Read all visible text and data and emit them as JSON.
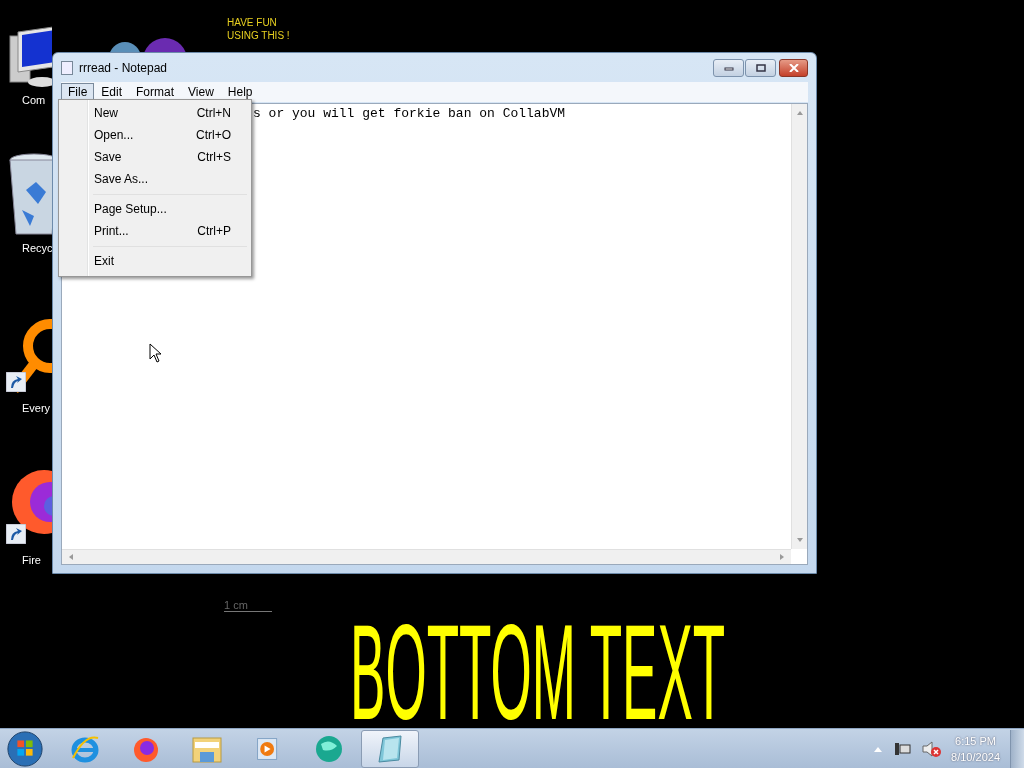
{
  "desktop_icons": [
    {
      "kind": "computer",
      "label": "Com"
    },
    {
      "kind": "recycle-bin",
      "label": "Recyc"
    },
    {
      "kind": "magnifier",
      "label": "Every",
      "shortcut": true
    },
    {
      "kind": "firefox",
      "label": "Fire",
      "shortcut": true
    }
  ],
  "note": [
    "HAVE FUN",
    "USING THIS !"
  ],
  "scale_label": "1 cm",
  "caption": "BOTTOM TEXT",
  "window": {
    "title": "rrread - Notepad",
    "menus": [
      {
        "label": "File",
        "selected": true
      },
      {
        "label": "Edit",
        "selected": false
      },
      {
        "label": "Format",
        "selected": false
      },
      {
        "label": "View",
        "selected": false
      },
      {
        "label": "Help",
        "selected": false
      }
    ],
    "open_menu": [
      {
        "kind": "item",
        "label": "New",
        "shortcut": "Ctrl+N"
      },
      {
        "kind": "item",
        "label": "Open...",
        "shortcut": "Ctrl+O"
      },
      {
        "kind": "item",
        "label": "Save",
        "shortcut": "Ctrl+S"
      },
      {
        "kind": "item",
        "label": "Save As..."
      },
      {
        "kind": "separator"
      },
      {
        "kind": "item",
        "label": "Page Setup..."
      },
      {
        "kind": "item",
        "label": "Print...",
        "shortcut": "Ctrl+P"
      },
      {
        "kind": "separator"
      },
      {
        "kind": "item",
        "label": "Exit"
      }
    ],
    "text": "s or you will get forkie ban on CollabVM"
  },
  "taskbar": {
    "apps": [
      {
        "kind": "ie",
        "active": false
      },
      {
        "kind": "firefox",
        "active": false
      },
      {
        "kind": "explorer",
        "active": false
      },
      {
        "kind": "media",
        "active": false
      },
      {
        "kind": "globe",
        "active": false
      },
      {
        "kind": "notepad",
        "active": true
      }
    ],
    "clock": {
      "time": "6:15 PM",
      "date": "8/10/2024"
    }
  }
}
